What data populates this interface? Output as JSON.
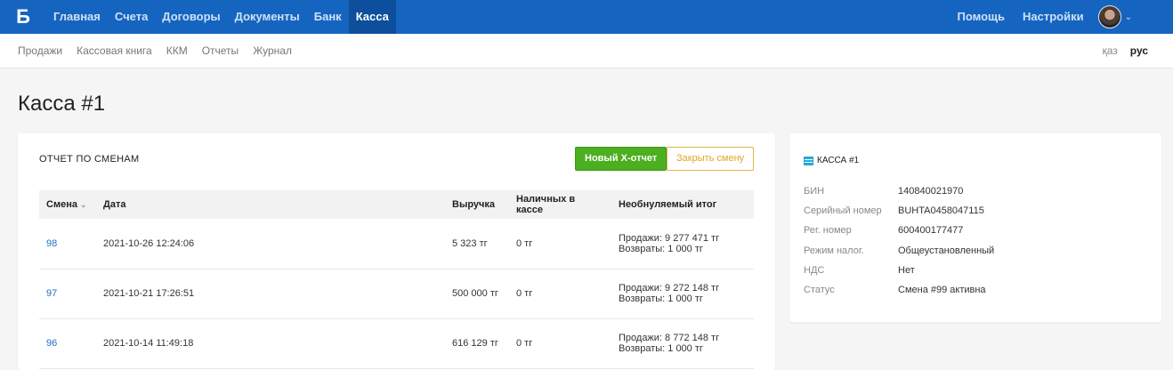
{
  "topnav": {
    "logo": "Б",
    "items": [
      "Главная",
      "Счета",
      "Договоры",
      "Документы",
      "Банк",
      "Касса"
    ],
    "active": "Касса",
    "right": [
      "Помощь",
      "Настройки"
    ],
    "caret": "⌄"
  },
  "subnav": {
    "items": [
      "Продажи",
      "Кассовая книга",
      "ККМ",
      "Отчеты",
      "Журнал"
    ],
    "lang": [
      "қаз",
      "рус"
    ],
    "lang_active": "рус"
  },
  "page": {
    "title": "Касса #1"
  },
  "report": {
    "title": "Отчет по сменам",
    "new_x_report": "Новый X-отчет",
    "close_shift": "Закрыть смену",
    "columns": [
      "Смена",
      "Дата",
      "Выручка",
      "Наличных в кассе",
      "Необнуляемый итог"
    ],
    "sort_icon": "⌄",
    "rows": [
      {
        "shift": "98",
        "date": "2021-10-26 12:24:06",
        "revenue": "5 323 тг",
        "cash": "0 тг",
        "sales": "Продажи: 9 277 471 тг",
        "returns": "Возвраты: 1 000 тг"
      },
      {
        "shift": "97",
        "date": "2021-10-21 17:26:51",
        "revenue": "500 000 тг",
        "cash": "0 тг",
        "sales": "Продажи: 9 272 148 тг",
        "returns": "Возвраты: 1 000 тг"
      },
      {
        "shift": "96",
        "date": "2021-10-14 11:49:18",
        "revenue": "616 129 тг",
        "cash": "0 тг",
        "sales": "Продажи: 8 772 148 тг",
        "returns": "Возвраты: 1 000 тг"
      }
    ]
  },
  "info": {
    "title": "Касса #1",
    "fields": [
      {
        "k": "БИН",
        "v": "140840021970"
      },
      {
        "k": "Серийный номер",
        "v": "BUHTA0458047115"
      },
      {
        "k": "Рег. номер",
        "v": "600400177477"
      },
      {
        "k": "Режим налог.",
        "v": "Общеустановленный"
      },
      {
        "k": "НДС",
        "v": "Нет"
      },
      {
        "k": "Статус",
        "v": "Смена #99 активна"
      }
    ]
  }
}
